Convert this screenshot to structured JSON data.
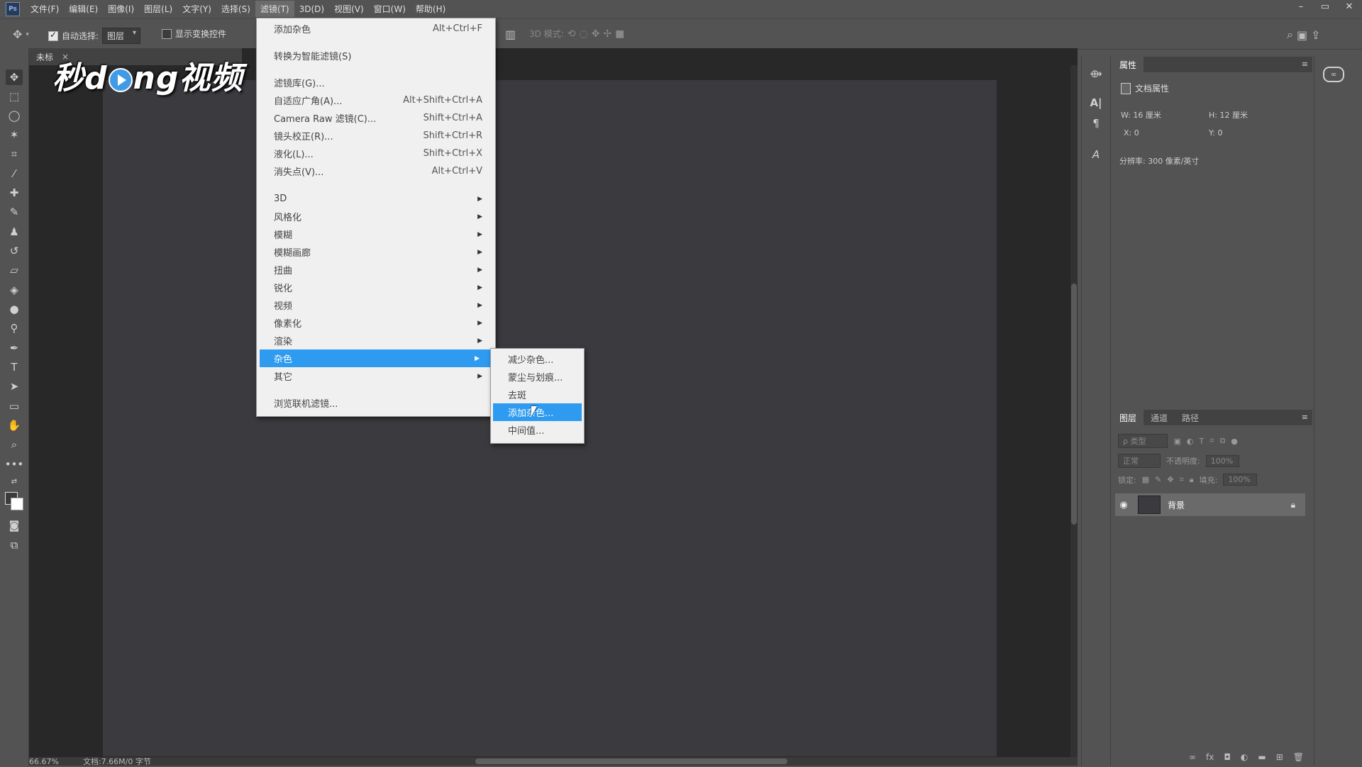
{
  "app": {
    "logo_text": "Ps"
  },
  "menubar": {
    "items": [
      "文件(F)",
      "编辑(E)",
      "图像(I)",
      "图层(L)",
      "文字(Y)",
      "选择(S)",
      "滤镜(T)",
      "3D(D)",
      "视图(V)",
      "窗口(W)",
      "帮助(H)"
    ],
    "active": "滤镜(T)",
    "window_controls": {
      "minimize": "–",
      "restore": "▭",
      "close": "✕"
    }
  },
  "options_bar": {
    "auto_select_label": "自动选择:",
    "auto_select_checked": true,
    "auto_select_value": "图层",
    "show_transform_label": "显示变换控件",
    "show_transform_checked": false,
    "mode_3d_label": "3D 模式:"
  },
  "document": {
    "tab_title": "未标",
    "tab_close": "×",
    "canvas_color": "#3b3a3e",
    "zoom": "66.67%",
    "doc_size": "文档:7.66M/0 字节"
  },
  "watermark": {
    "text_before": "秒d",
    "text_after": "ng视频"
  },
  "filter_menu": {
    "items": [
      {
        "label": "添加杂色",
        "shortcut": "Alt+Ctrl+F"
      },
      {
        "label": "转换为智能滤镜(S)",
        "shortcut": ""
      },
      {
        "label": "滤镜库(G)...",
        "shortcut": ""
      },
      {
        "label": "自适应广角(A)...",
        "shortcut": "Alt+Shift+Ctrl+A"
      },
      {
        "label": "Camera Raw 滤镜(C)...",
        "shortcut": "Shift+Ctrl+A"
      },
      {
        "label": "镜头校正(R)...",
        "shortcut": "Shift+Ctrl+R"
      },
      {
        "label": "液化(L)...",
        "shortcut": "Shift+Ctrl+X"
      },
      {
        "label": "消失点(V)...",
        "shortcut": "Alt+Ctrl+V"
      },
      {
        "label": "3D",
        "submenu": true
      },
      {
        "label": "风格化",
        "submenu": true
      },
      {
        "label": "模糊",
        "submenu": true
      },
      {
        "label": "模糊画廊",
        "submenu": true
      },
      {
        "label": "扭曲",
        "submenu": true
      },
      {
        "label": "锐化",
        "submenu": true
      },
      {
        "label": "视频",
        "submenu": true
      },
      {
        "label": "像素化",
        "submenu": true
      },
      {
        "label": "渲染",
        "submenu": true
      },
      {
        "label": "杂色",
        "submenu": true,
        "highlighted": true
      },
      {
        "label": "其它",
        "submenu": true
      },
      {
        "label": "浏览联机滤镜...",
        "shortcut": ""
      }
    ],
    "arrow_glyph": "▶"
  },
  "noise_submenu": {
    "items": [
      "减少杂色...",
      "蒙尘与划痕...",
      "去斑",
      "添加杂色...",
      "中间值..."
    ],
    "highlighted": "添加杂色..."
  },
  "properties_panel": {
    "tab": "属性",
    "menu_glyph": "≡",
    "section_title": "文档属性",
    "width": "W:  16 厘米",
    "height": "H:  12 厘米",
    "x": "X:  0",
    "y": "Y:  0",
    "resolution": "分辨率: 300 像素/英寸"
  },
  "layers_panel": {
    "tabs": [
      "图层",
      "通道",
      "路径"
    ],
    "active_tab": "图层",
    "menu_glyph": "≡",
    "filter_placeholder": "ρ 类型",
    "blend_mode": "正常",
    "opacity_label": "不透明度:",
    "opacity_value": "100%",
    "lock_label": "锁定:",
    "fill_label": "填充:",
    "fill_value": "100%",
    "layers": [
      {
        "name": "背景",
        "visible": true,
        "locked": true
      }
    ],
    "footer_icons": [
      "link-icon",
      "fx-icon",
      "mask-icon",
      "adjustment-icon",
      "folder-icon",
      "new-layer-icon",
      "trash-icon"
    ]
  },
  "colors": {
    "accent": "#2e9bf0",
    "chrome": "#535353",
    "menu_bg": "#f0f0f0"
  }
}
